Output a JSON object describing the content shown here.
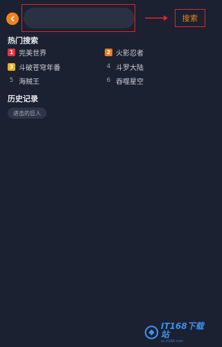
{
  "header": {
    "back_icon": "chevron-left-icon",
    "search_placeholder": "",
    "search_button_label": "搜索",
    "accent_color": "#f0821e",
    "annotation_color": "#e0262e"
  },
  "hot_search": {
    "title": "热门搜索",
    "items": [
      {
        "rank": "1",
        "label": "完美世界",
        "badge_color": "#e3343b"
      },
      {
        "rank": "2",
        "label": "火影忍者",
        "badge_color": "#ef7a1a"
      },
      {
        "rank": "3",
        "label": "斗破苍穹年番",
        "badge_color": "#e9b21c"
      },
      {
        "rank": "4",
        "label": "斗罗大陆",
        "badge_color": ""
      },
      {
        "rank": "5",
        "label": "海贼王",
        "badge_color": ""
      },
      {
        "rank": "6",
        "label": "吞噬星空",
        "badge_color": ""
      }
    ]
  },
  "history": {
    "title": "历史记录",
    "items": [
      "进击的巨人"
    ]
  },
  "watermark": {
    "main": "IT168下载站",
    "sub": "xz.it168.com"
  }
}
